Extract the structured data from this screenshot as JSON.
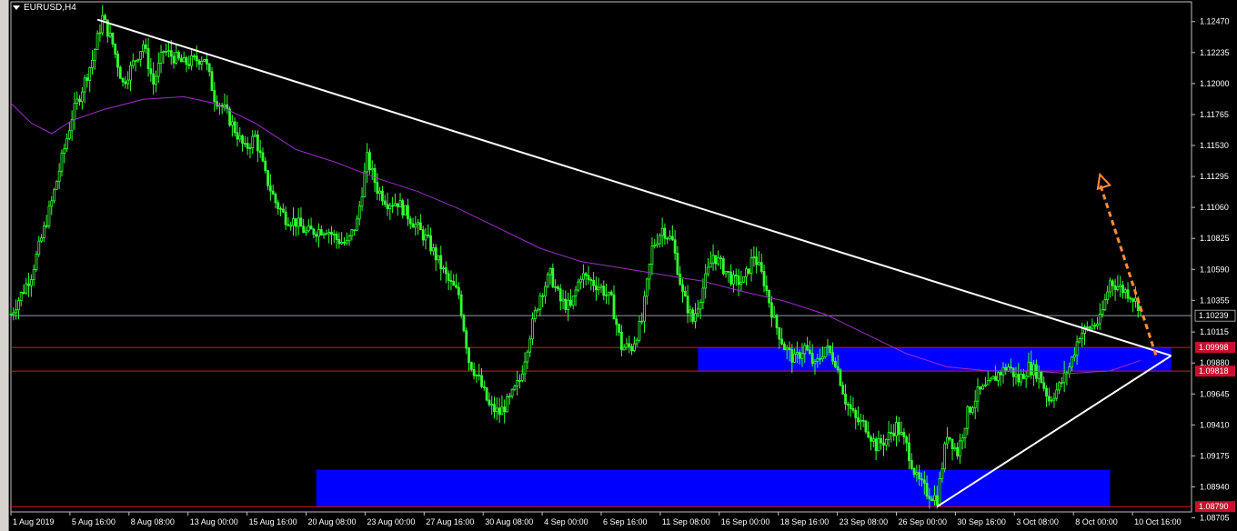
{
  "window": {
    "title": "EURUSD,H4"
  },
  "colors": {
    "background": "#000000",
    "candle": "#33ff33",
    "ma": "#9a2fc8",
    "zone": "#0000ff",
    "trendline": "#ffffff",
    "level_line": "#d81818",
    "bid_line": "#9a9aaa",
    "arrow": "#ff8c3a",
    "price_tag_bg": "#c8102e"
  },
  "chart_data": {
    "type": "candlestick",
    "symbol": "EURUSD",
    "timeframe": "H4",
    "ylim": [
      1.0875,
      1.1262
    ],
    "y_ticks": [
      "1.12470",
      "1.12235",
      "1.12000",
      "1.11765",
      "1.11530",
      "1.11295",
      "1.11060",
      "1.10825",
      "1.10590",
      "1.10355",
      "1.10115",
      "1.09880",
      "1.09645",
      "1.09410",
      "1.09175",
      "1.08940",
      "1.08705"
    ],
    "x_labels": [
      "1 Aug 2019",
      "5 Aug 16:00",
      "8 Aug 08:00",
      "13 Aug 00:00",
      "15 Aug 16:00",
      "20 Aug 08:00",
      "23 Aug 00:00",
      "27 Aug 16:00",
      "30 Aug 08:00",
      "4 Sep 00:00",
      "6 Sep 16:00",
      "11 Sep 08:00",
      "16 Sep 00:00",
      "18 Sep 16:00",
      "23 Sep 08:00",
      "26 Sep 00:00",
      "30 Sep 16:00",
      "3 Oct 08:00",
      "8 Oct 00:00",
      "10 Oct 16:00"
    ],
    "close_path": [
      [
        0,
        1.1025
      ],
      [
        2,
        1.1055
      ],
      [
        4,
        1.111
      ],
      [
        6,
        1.1175
      ],
      [
        8,
        1.1218
      ],
      [
        9,
        1.125
      ],
      [
        10,
        1.123
      ],
      [
        11,
        1.12
      ],
      [
        13,
        1.123
      ],
      [
        14,
        1.12
      ],
      [
        15,
        1.1225
      ],
      [
        17,
        1.1215
      ],
      [
        19,
        1.122
      ],
      [
        20,
        1.119
      ],
      [
        21,
        1.118
      ],
      [
        23,
        1.115
      ],
      [
        24,
        1.116
      ],
      [
        25,
        1.113
      ],
      [
        26,
        1.111
      ],
      [
        27,
        1.1098
      ],
      [
        28,
        1.1095
      ],
      [
        29,
        1.1087
      ],
      [
        31,
        1.109
      ],
      [
        32,
        1.1082
      ],
      [
        33,
        1.1078
      ],
      [
        34,
        1.1095
      ],
      [
        35,
        1.1143
      ],
      [
        36,
        1.112
      ],
      [
        37,
        1.111
      ],
      [
        38,
        1.111
      ],
      [
        39,
        1.11
      ],
      [
        40,
        1.109
      ],
      [
        41,
        1.108
      ],
      [
        42,
        1.1065
      ],
      [
        43,
        1.105
      ],
      [
        44,
        1.104
      ],
      [
        45,
        1.099
      ],
      [
        46,
        1.0975
      ],
      [
        47,
        1.0955
      ],
      [
        48,
        1.095
      ],
      [
        49,
        1.096
      ],
      [
        50,
        1.0975
      ],
      [
        51,
        1.101
      ],
      [
        52,
        1.104
      ],
      [
        53,
        1.1055
      ],
      [
        54,
        1.1035
      ],
      [
        55,
        1.103
      ],
      [
        56,
        1.1055
      ],
      [
        57,
        1.105
      ],
      [
        58,
        1.1045
      ],
      [
        59,
        1.1035
      ],
      [
        60,
        1.1
      ],
      [
        61,
        1.1
      ],
      [
        62,
        1.102
      ],
      [
        63,
        1.1075
      ],
      [
        64,
        1.109
      ],
      [
        65,
        1.108
      ],
      [
        66,
        1.104
      ],
      [
        67,
        1.102
      ],
      [
        68,
        1.1045
      ],
      [
        69,
        1.107
      ],
      [
        70,
        1.106
      ],
      [
        71,
        1.105
      ],
      [
        72,
        1.105
      ],
      [
        73,
        1.107
      ],
      [
        74,
        1.105
      ],
      [
        75,
        1.102
      ],
      [
        76,
        1.1
      ],
      [
        77,
        1.099
      ],
      [
        78,
        1.1
      ],
      [
        79,
        1.0985
      ],
      [
        80,
        1.1
      ],
      [
        81,
        1.099
      ],
      [
        82,
        1.096
      ],
      [
        83,
        1.0945
      ],
      [
        84,
        1.094
      ],
      [
        85,
        1.0925
      ],
      [
        86,
        1.093
      ],
      [
        87,
        1.094
      ],
      [
        88,
        1.0925
      ],
      [
        89,
        1.09
      ],
      [
        90,
        1.089
      ],
      [
        91,
        1.0885
      ],
      [
        92,
        1.0935
      ],
      [
        93,
        1.092
      ],
      [
        94,
        1.095
      ],
      [
        95,
        1.0965
      ],
      [
        96,
        1.097
      ],
      [
        97,
        1.098
      ],
      [
        98,
        1.0985
      ],
      [
        99,
        1.0975
      ],
      [
        100,
        1.0985
      ],
      [
        101,
        1.098
      ],
      [
        102,
        1.096
      ],
      [
        103,
        1.097
      ],
      [
        104,
        1.0985
      ],
      [
        105,
        1.101
      ],
      [
        106,
        1.1015
      ],
      [
        107,
        1.102
      ],
      [
        108,
        1.105
      ],
      [
        109,
        1.1045
      ],
      [
        110,
        1.104
      ],
      [
        111,
        1.103
      ]
    ],
    "moving_average_path": [
      [
        0,
        1.1185
      ],
      [
        2,
        1.117
      ],
      [
        4,
        1.1162
      ],
      [
        6,
        1.1172
      ],
      [
        9,
        1.118
      ],
      [
        13,
        1.1188
      ],
      [
        17,
        1.119
      ],
      [
        20,
        1.1185
      ],
      [
        24,
        1.117
      ],
      [
        28,
        1.115
      ],
      [
        32,
        1.114
      ],
      [
        36,
        1.1128
      ],
      [
        40,
        1.1118
      ],
      [
        44,
        1.1105
      ],
      [
        48,
        1.109
      ],
      [
        52,
        1.1075
      ],
      [
        56,
        1.1065
      ],
      [
        60,
        1.106
      ],
      [
        64,
        1.1055
      ],
      [
        68,
        1.105
      ],
      [
        72,
        1.1042
      ],
      [
        76,
        1.1035
      ],
      [
        80,
        1.1025
      ],
      [
        84,
        1.101
      ],
      [
        88,
        1.0995
      ],
      [
        92,
        1.0985
      ],
      [
        96,
        1.0982
      ],
      [
        100,
        1.0982
      ],
      [
        104,
        1.098
      ],
      [
        108,
        1.0982
      ],
      [
        111,
        1.099
      ]
    ],
    "price_tags": [
      "1.10239",
      "1.09998",
      "1.09818",
      "1.08790"
    ],
    "bid_level": 1.10239,
    "resistance_levels": [
      1.09998,
      1.09818
    ],
    "support_level": 1.0879,
    "zones": [
      {
        "from_bar": 67.5,
        "to_bar": 114,
        "low": 1.09818,
        "high": 1.09998
      },
      {
        "from_bar": 30,
        "to_bar": 108,
        "low": 1.0879,
        "high": 1.0907
      }
    ],
    "trendlines": [
      {
        "from": [
          8.5,
          1.12485
        ],
        "to": [
          114,
          1.09935
        ]
      },
      {
        "from": [
          91,
          1.0879
        ],
        "to": [
          114,
          1.09935
        ]
      }
    ],
    "arrow": {
      "from": [
        112.5,
        1.0994
      ],
      "to": [
        107,
        1.1131
      ]
    },
    "x_per_label": 6,
    "n_bars": 112
  }
}
